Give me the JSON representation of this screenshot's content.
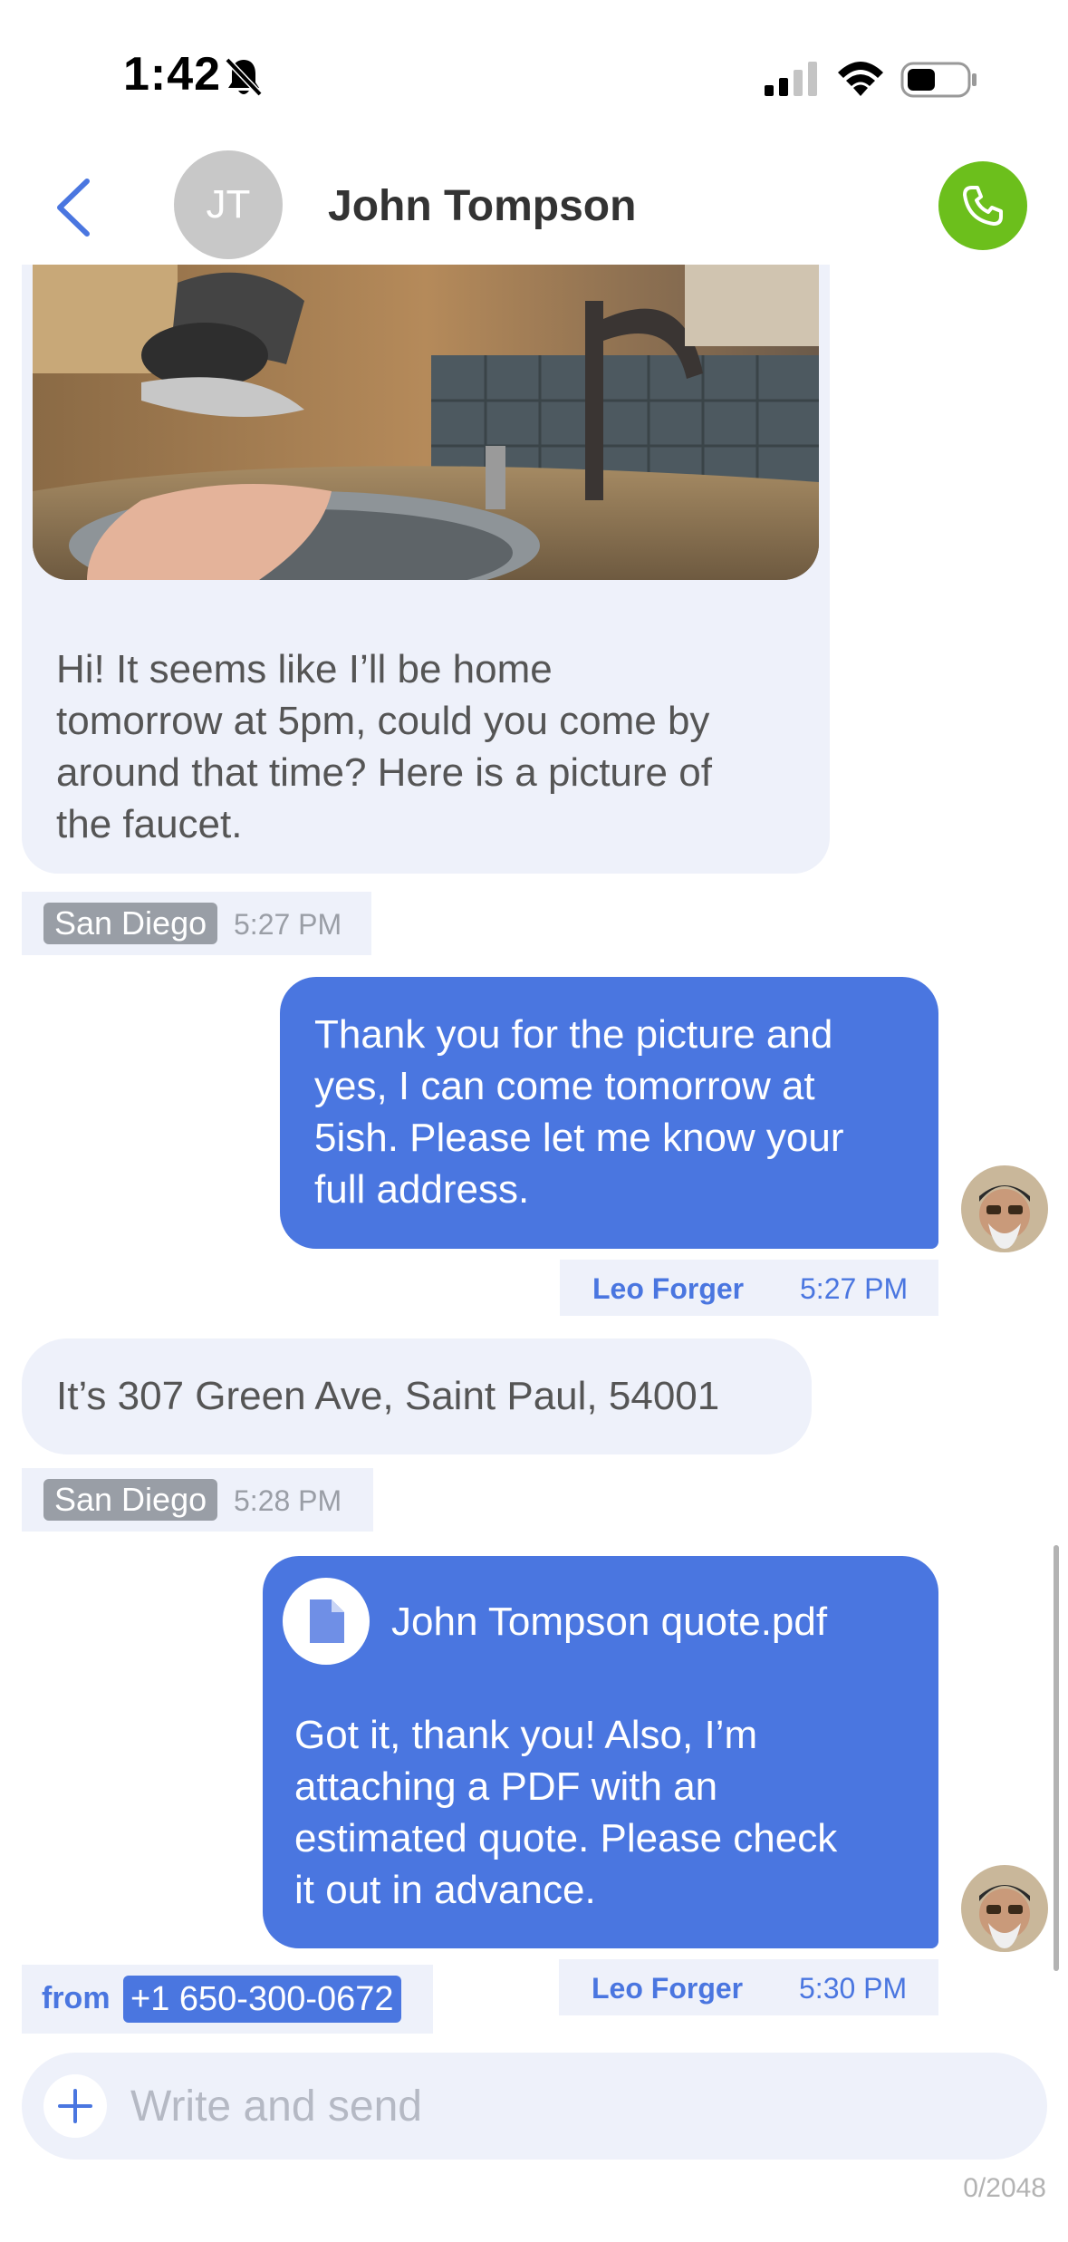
{
  "status_bar": {
    "time": "1:42",
    "icons": [
      "bell-slash-icon",
      "cellular-signal-icon",
      "wifi-icon",
      "battery-icon"
    ]
  },
  "header": {
    "back_icon": "chevron-left-icon",
    "avatar_initials": "JT",
    "contact_name": "John Tompson",
    "call_icon": "phone-icon"
  },
  "messages": [
    {
      "direction": "incoming",
      "attachment": "faucet-photo",
      "lines": [
        "Hi! It seems like I’ll be home",
        "tomorrow at 5pm, could you come by",
        "around that time? Here is a picture of",
        "the faucet."
      ],
      "location": "San Diego",
      "time": "5:27 PM"
    },
    {
      "direction": "outgoing",
      "lines": [
        "Thank you for the picture and",
        "yes, I can come tomorrow at",
        "5ish. Please let me know your",
        "full address."
      ],
      "sender": "Leo Forger",
      "time": "5:27 PM"
    },
    {
      "direction": "incoming",
      "lines": [
        "It’s 307 Green Ave, Saint Paul, 54001"
      ],
      "location": "San Diego",
      "time": "5:28 PM"
    },
    {
      "direction": "outgoing",
      "file_name": "John Tompson quote.pdf",
      "file_icon": "document-icon",
      "lines": [
        "Got it, thank you! Also, I’m",
        "attaching a PDF with an",
        "estimated quote. Please check",
        "it out in advance."
      ],
      "sender": "Leo Forger",
      "time": "5:30 PM"
    }
  ],
  "from_line": {
    "label": "from",
    "phone": "+1 650-300-0672"
  },
  "composer": {
    "placeholder": "Write and send",
    "value": "",
    "char_counter": "0/2048",
    "add_icon": "plus-icon"
  },
  "colors": {
    "accent": "#4a76e0",
    "call_green": "#6cbf1c",
    "incoming_bg": "#eef1fa",
    "location_chip": "#999ea6"
  }
}
